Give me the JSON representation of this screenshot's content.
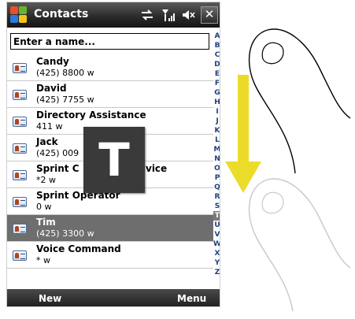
{
  "app": {
    "title": "Contacts",
    "close_label": "✕"
  },
  "status_icons": [
    "sync-icon",
    "signal-icon",
    "speaker-muted-icon"
  ],
  "search": {
    "placeholder": "Enter a name...",
    "value": "Enter a name..."
  },
  "contacts": [
    {
      "name": "Candy",
      "phone": "(425) 8800  w"
    },
    {
      "name": "David",
      "phone": "(425) 7755  w"
    },
    {
      "name": "Directory Assistance",
      "phone": "411  w"
    },
    {
      "name": "Jack",
      "phone": "(425) 009"
    },
    {
      "name": "Sprint C",
      "name_tail": "vice",
      "phone": "*2  w"
    },
    {
      "name": "Sprint Operator",
      "phone": "0  w"
    },
    {
      "name": "Tim",
      "phone": "(425) 3300  w",
      "selected": true
    },
    {
      "name": "Voice Command",
      "phone": "*  w"
    }
  ],
  "alphabet": [
    "A",
    "B",
    "C",
    "D",
    "E",
    "F",
    "G",
    "H",
    "I",
    "J",
    "K",
    "L",
    "M",
    "N",
    "O",
    "P",
    "Q",
    "R",
    "S",
    "T",
    "U",
    "V",
    "W",
    "X",
    "Y",
    "Z"
  ],
  "alphabet_active": "T",
  "overlay_letter": "T",
  "softkeys": {
    "left": "New",
    "right": "Menu"
  },
  "colors": {
    "titlebar": "#2c2c2c",
    "selected_row": "#6e6e6e",
    "alpha_letters": "#1f3f7a",
    "overlay": "#3a3a3a",
    "arrow": "#ecdc2a"
  }
}
